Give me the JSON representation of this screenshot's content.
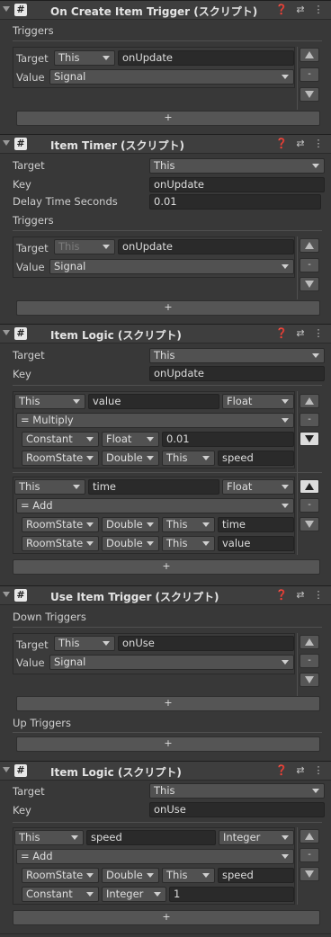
{
  "icons": {
    "script": "#",
    "help": "❓",
    "preset": "⇄",
    "menu": "⋮",
    "fold": "triangle-down-icon"
  },
  "c1": {
    "title": "On Create Item Trigger (スクリプト)",
    "triggers_label": "Triggers",
    "row1": {
      "label": "Target",
      "target": "This",
      "key": "onUpdate"
    },
    "row2": {
      "label": "Value",
      "value": "Signal"
    },
    "minus": "-",
    "plus": "+"
  },
  "c2": {
    "title": "Item Timer (スクリプト)",
    "target_label": "Target",
    "target_value": "This",
    "key_label": "Key",
    "key_value": "onUpdate",
    "delay_label": "Delay Time Seconds",
    "delay_value": "0.01",
    "triggers_label": "Triggers",
    "row1": {
      "label": "Target",
      "target": "This",
      "key": "onUpdate"
    },
    "row2": {
      "label": "Value",
      "value": "Signal"
    },
    "minus": "-",
    "plus": "+"
  },
  "c3": {
    "title": "Item Logic (スクリプト)",
    "target_label": "Target",
    "target_value": "This",
    "key_label": "Key",
    "key_value": "onUpdate",
    "e1": {
      "src": "This",
      "name": "value",
      "type": "Float",
      "op": "= Multiply",
      "a": {
        "kind": "Constant",
        "type": "Float",
        "val": "0.01"
      },
      "b": {
        "kind": "RoomState",
        "type": "Double",
        "target": "This",
        "val": "speed"
      }
    },
    "e2": {
      "src": "This",
      "name": "time",
      "type": "Float",
      "op": "= Add",
      "a": {
        "kind": "RoomState",
        "type": "Double",
        "target": "This",
        "val": "time"
      },
      "b": {
        "kind": "RoomState",
        "type": "Double",
        "target": "This",
        "val": "value"
      }
    },
    "minus": "-",
    "plus": "+"
  },
  "c4": {
    "title": "Use Item Trigger (スクリプト)",
    "down_label": "Down Triggers",
    "row1": {
      "label": "Target",
      "target": "This",
      "key": "onUse"
    },
    "row2": {
      "label": "Value",
      "value": "Signal"
    },
    "up_label": "Up Triggers",
    "minus": "-",
    "plus": "+"
  },
  "c5": {
    "title": "Item Logic (スクリプト)",
    "target_label": "Target",
    "target_value": "This",
    "key_label": "Key",
    "key_value": "onUse",
    "e1": {
      "src": "This",
      "name": "speed",
      "type": "Integer",
      "op": "= Add",
      "a": {
        "kind": "RoomState",
        "type": "Double",
        "target": "This",
        "val": "speed"
      },
      "b": {
        "kind": "Constant",
        "type": "Integer",
        "val": "1"
      }
    },
    "minus": "-",
    "plus": "+"
  }
}
